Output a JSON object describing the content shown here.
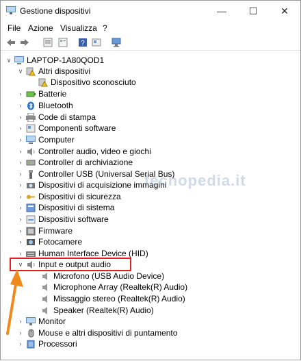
{
  "window": {
    "title": "Gestione dispositivi"
  },
  "menu": [
    "File",
    "Azione",
    "Visualizza",
    "?"
  ],
  "watermark": "tecnopedia.it",
  "tree": {
    "root": "LAPTOP-1A80QOD1",
    "other_devices": "Altri dispositivi",
    "unknown_device": "Dispositivo sconosciuto",
    "categories": [
      "Batterie",
      "Bluetooth",
      "Code di stampa",
      "Componenti software",
      "Computer",
      "Controller audio, video e giochi",
      "Controller di archiviazione",
      "Controller USB (Universal Serial Bus)",
      "Dispositivi di acquisizione immagini",
      "Dispositivi di sicurezza",
      "Dispositivi di sistema",
      "Dispositivi software",
      "Firmware",
      "Fotocamere",
      "Human Interface Device (HID)"
    ],
    "audio_io": "Input e output audio",
    "audio_children": [
      "Microfono (USB Audio Device)",
      "Microphone Array (Realtek(R) Audio)",
      "Missaggio stereo (Realtek(R) Audio)",
      "Speaker (Realtek(R) Audio)"
    ],
    "after": [
      "Monitor",
      "Mouse e altri dispositivi di puntamento",
      "Processori"
    ]
  },
  "colors": {
    "highlight": "#e02020",
    "pointer": "#f08a1c"
  }
}
